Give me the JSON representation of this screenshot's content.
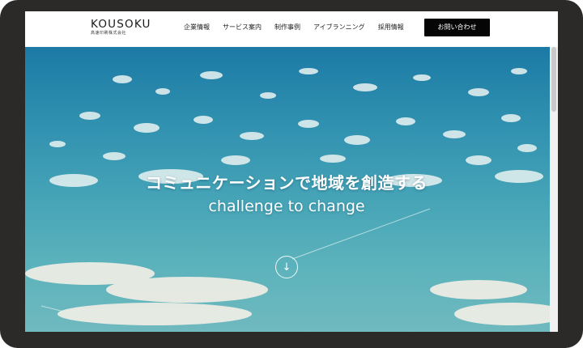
{
  "header": {
    "logo": "KOUSOKU",
    "logo_sub": "高速印刷株式会社",
    "nav": [
      "企業情報",
      "サービス案内",
      "制作事例",
      "アイブランニング",
      "採用情報"
    ],
    "contact_label": "お問い合わせ"
  },
  "hero": {
    "title": "コミュニケーションで地域を創造する",
    "subtitle": "challenge to change",
    "scroll_icon": "arrow-down-circle-icon"
  },
  "colors": {
    "sky_top": "#1c7aa5",
    "sky_bottom": "#5cb0b6",
    "button_bg": "#050505",
    "device_frame": "#2b2a29"
  }
}
